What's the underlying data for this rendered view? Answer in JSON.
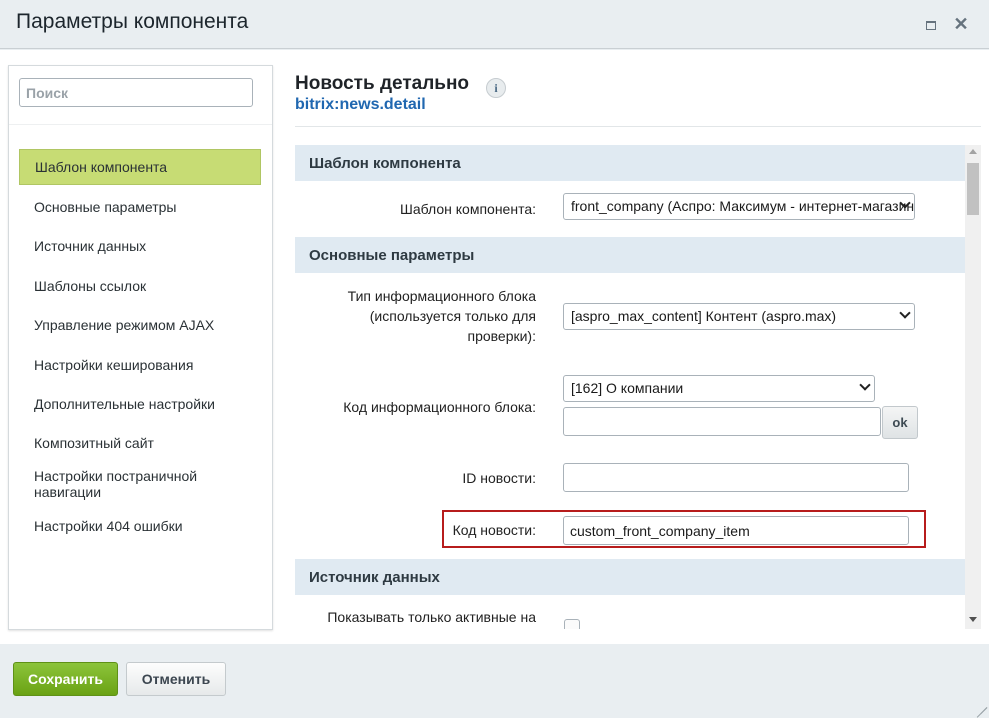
{
  "window": {
    "title": "Параметры компонента"
  },
  "sidebar": {
    "search_placeholder": "Поиск",
    "items": [
      {
        "label": "Шаблон компонента",
        "active": true
      },
      {
        "label": "Основные параметры"
      },
      {
        "label": "Источник данных"
      },
      {
        "label": "Шаблоны ссылок"
      },
      {
        "label": "Управление режимом AJAX"
      },
      {
        "label": "Настройки кеширования"
      },
      {
        "label": "Дополнительные настройки"
      },
      {
        "label": "Композитный сайт"
      },
      {
        "label": "Настройки постраничной навигации"
      },
      {
        "label": "Настройки 404 ошибки"
      }
    ]
  },
  "component": {
    "name": "Новость детально",
    "code": "bitrix:news.detail",
    "info_icon": "i"
  },
  "sections": {
    "template": "Шаблон компонента",
    "main": "Основные параметры",
    "source": "Источник данных"
  },
  "fields": {
    "template_label": "Шаблон компонента:",
    "template_value": "front_company (Аспро: Максимум - интернет-магазин)",
    "iblock_type_label": "Тип информационного блока (используется только для проверки):",
    "iblock_type_value": "[aspro_max_content] Контент (aspro.max)",
    "iblock_code_label": "Код информационного блока:",
    "iblock_code_value": "[162] О компании",
    "iblock_code_extra": "",
    "ok_label": "ok",
    "news_id_label": "ID новости:",
    "news_id_value": "",
    "news_code_label": "Код новости:",
    "news_code_value": "custom_front_company_item",
    "active_only_label": "Показывать только активные на"
  },
  "footer": {
    "save_label": "Сохранить",
    "cancel_label": "Отменить"
  },
  "colors": {
    "active_item": "#c7dc74",
    "section_bg": "#e0eaf2",
    "highlight": "#b71c1c",
    "save_button": "#7bb429",
    "link": "#2067b0"
  }
}
